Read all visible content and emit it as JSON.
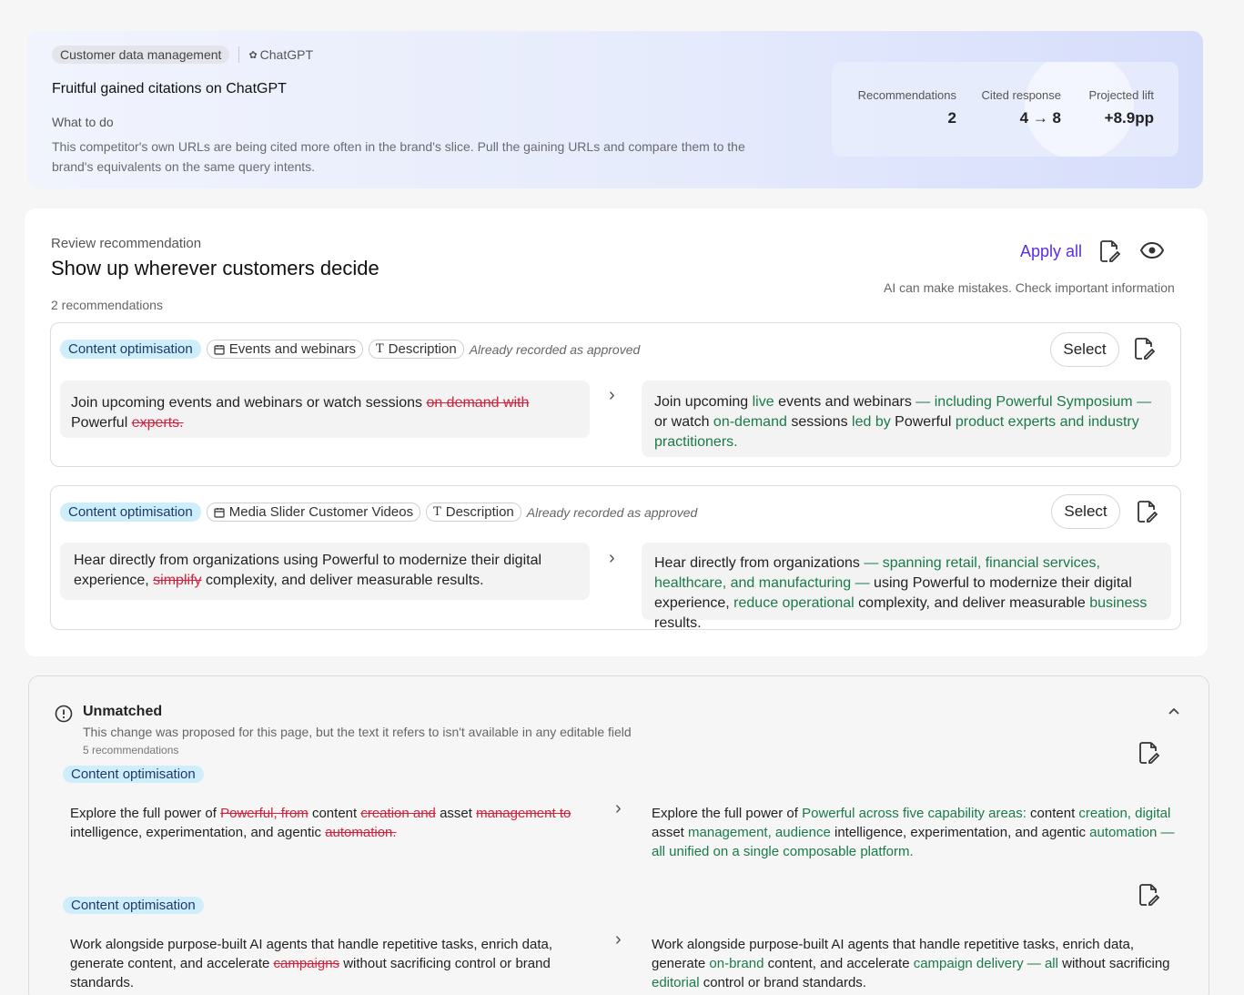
{
  "hero": {
    "chip_category": "Customer data management",
    "chip_source": "ChatGPT",
    "title": "Fruitful gained citations on ChatGPT",
    "what_to_do_label": "What to do",
    "description": "This competitor's own URLs are being cited more often in the brand's slice. Pull the gaining URLs and compare them to the brand's equivalents on the same query intents.",
    "stats": [
      {
        "label": "Recommendations",
        "value": "2"
      },
      {
        "label": "Cited response",
        "value": "4 → 8"
      },
      {
        "label": "Projected lift",
        "value": "+8.9pp"
      }
    ]
  },
  "review": {
    "kicker": "Review recommendation",
    "title": "Show up wherever customers decide",
    "count": "2 recommendations",
    "apply_all": "Apply all",
    "disclaimer": "AI can make mistakes. Check important information",
    "recommendations": [
      {
        "type": "Content optimisation",
        "section": "Events and webinars",
        "field": "Description",
        "status": "Already recorded as approved",
        "select_label": "Select",
        "original": [
          {
            "t": "Join upcoming events and webinars or watch sessions ",
            "k": "n"
          },
          {
            "t": "on demand with",
            "k": "d"
          },
          {
            "t": " Powerful ",
            "k": "n"
          },
          {
            "t": "experts.",
            "k": "d"
          }
        ],
        "revised": [
          {
            "t": "Join upcoming ",
            "k": "n"
          },
          {
            "t": "live",
            "k": "a"
          },
          {
            "t": " events and webinars ",
            "k": "n"
          },
          {
            "t": "— including Powerful Symposium —",
            "k": "a"
          },
          {
            "t": " or watch ",
            "k": "n"
          },
          {
            "t": "on-demand",
            "k": "a"
          },
          {
            "t": " sessions ",
            "k": "n"
          },
          {
            "t": "led by",
            "k": "a"
          },
          {
            "t": " Powerful ",
            "k": "n"
          },
          {
            "t": "product experts and industry practitioners.",
            "k": "a"
          }
        ]
      },
      {
        "type": "Content optimisation",
        "section": "Media Slider Customer Videos",
        "field": "Description",
        "status": "Already recorded as approved",
        "select_label": "Select",
        "original": [
          {
            "t": "Hear directly from organizations using Powerful to modernize their digital experience, ",
            "k": "n"
          },
          {
            "t": "simplify",
            "k": "d"
          },
          {
            "t": " complexity, and deliver measurable results.",
            "k": "n"
          }
        ],
        "revised": [
          {
            "t": "Hear directly from organizations ",
            "k": "n"
          },
          {
            "t": "— spanning retail, financial services, healthcare, and manufacturing —",
            "k": "a"
          },
          {
            "t": " using Powerful to modernize their digital experience, ",
            "k": "n"
          },
          {
            "t": "reduce operational",
            "k": "a"
          },
          {
            "t": " complexity, and deliver measurable ",
            "k": "n"
          },
          {
            "t": "business",
            "k": "a"
          },
          {
            "t": " results.",
            "k": "n"
          }
        ]
      }
    ]
  },
  "unmatched": {
    "title": "Unmatched",
    "description": "This change was proposed for this page, but the text it refers to isn't available in any editable field",
    "count": "5 recommendations",
    "items": [
      {
        "type": "Content optimisation",
        "original": [
          {
            "t": "Explore the full power of ",
            "k": "n"
          },
          {
            "t": "Powerful, from",
            "k": "d"
          },
          {
            "t": " content ",
            "k": "n"
          },
          {
            "t": "creation and",
            "k": "d"
          },
          {
            "t": " asset ",
            "k": "n"
          },
          {
            "t": "management to",
            "k": "d"
          },
          {
            "t": " intelligence, experimentation, and agentic ",
            "k": "n"
          },
          {
            "t": "automation.",
            "k": "d"
          }
        ],
        "revised": [
          {
            "t": "Explore the full power of ",
            "k": "n"
          },
          {
            "t": "Powerful across five capability areas:",
            "k": "a"
          },
          {
            "t": " content ",
            "k": "n"
          },
          {
            "t": "creation, digital",
            "k": "a"
          },
          {
            "t": " asset ",
            "k": "n"
          },
          {
            "t": "management, audience",
            "k": "a"
          },
          {
            "t": " intelligence, experimentation, and agentic ",
            "k": "n"
          },
          {
            "t": "automation — all unified on a single composable platform.",
            "k": "a"
          }
        ]
      },
      {
        "type": "Content optimisation",
        "original": [
          {
            "t": "Work alongside purpose-built AI agents that handle repetitive tasks, enrich data, generate content, and accelerate ",
            "k": "n"
          },
          {
            "t": "campaigns",
            "k": "d"
          },
          {
            "t": " without sacrificing control or brand standards.",
            "k": "n"
          }
        ],
        "revised": [
          {
            "t": "Work alongside purpose-built AI agents that handle repetitive tasks, enrich data, generate ",
            "k": "n"
          },
          {
            "t": "on-brand",
            "k": "a"
          },
          {
            "t": " content, and accelerate ",
            "k": "n"
          },
          {
            "t": "campaign delivery — all",
            "k": "a"
          },
          {
            "t": " without sacrificing ",
            "k": "n"
          },
          {
            "t": "editorial",
            "k": "a"
          },
          {
            "t": " control or brand standards.",
            "k": "n"
          }
        ]
      }
    ]
  },
  "colors": {
    "accent": "#5a2ee0",
    "deleted": "#d0223c",
    "added": "#1a7a4a",
    "tag": "#cfeefb"
  }
}
